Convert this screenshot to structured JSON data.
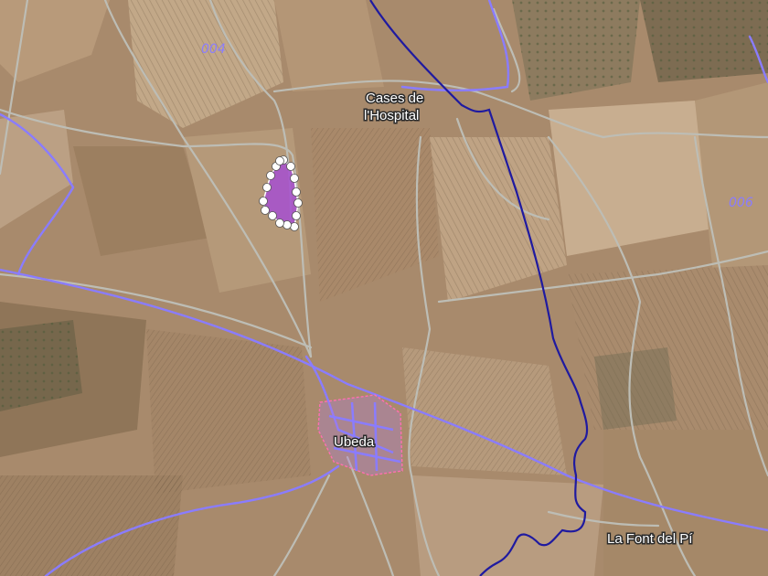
{
  "map": {
    "labels": {
      "cases_line1": "Cases de",
      "cases_line2": "l'Hospital",
      "town": "Ubeda",
      "font_del_pi": "La Font del Pí"
    },
    "parcel_codes": {
      "north_west": "004",
      "east": "006"
    },
    "colors": {
      "boundary_line": "#1f1aa0",
      "road_line": "#8a7cff",
      "track_line": "#bdbdb5",
      "parcel_fill": "#a64fd0",
      "vertex_fill": "#ffffff",
      "settlement_outline": "#ff6fb0",
      "terrain_base": "#a88a6c"
    },
    "selected_parcel": {
      "type": "polygon",
      "vertex_count": 17
    }
  }
}
